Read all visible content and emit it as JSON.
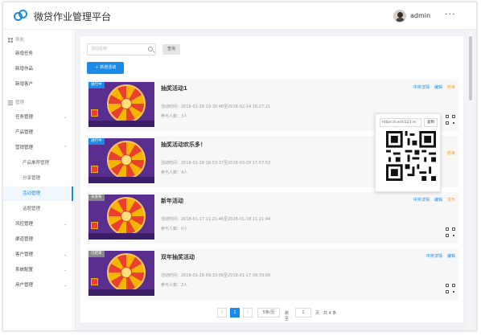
{
  "header": {
    "app_title": "微贷作业管理平台",
    "username": "admin",
    "more": "···"
  },
  "sidebar": {
    "group1": "导航",
    "group1_items": [
      "新增任务",
      "新增作品",
      "新增客户"
    ],
    "group2": "管理",
    "items": [
      {
        "label": "任务管理",
        "caret": "⌄"
      },
      {
        "label": "产品管理",
        "caret": ""
      },
      {
        "label": "营销管理",
        "caret": "⌃"
      },
      {
        "label": "产品推荐管理",
        "caret": ""
      },
      {
        "label": "分享管理",
        "caret": ""
      },
      {
        "label": "活动管理",
        "caret": ""
      },
      {
        "label": "话题管理",
        "caret": ""
      },
      {
        "label": "风控管理",
        "caret": "⌄"
      },
      {
        "label": "渠道管理",
        "caret": ""
      },
      {
        "label": "客户管理",
        "caret": "⌄"
      },
      {
        "label": "系统配置",
        "caret": "⌄"
      },
      {
        "label": "用户管理",
        "caret": "⌄"
      }
    ]
  },
  "toolbar": {
    "search_placeholder": "活动名称",
    "search_button": "查询",
    "add_button": "＋ 新增活动"
  },
  "cards": [
    {
      "badge": "进行中",
      "title": "抽奖活动1",
      "time": "活动时间：2018-01-18 19:30:48至2018-02-14 16:27:21",
      "people": "参与人数：3人",
      "links": [
        "中奖详情",
        "编辑",
        "结束"
      ]
    },
    {
      "badge": "进行中",
      "title": "抽奖活动欢乐多！",
      "time": "活动时间：2018-01-18 16:53:37至2018-03-29 17:57:53",
      "people": "参与人数：4人",
      "links": [
        "结束"
      ]
    },
    {
      "badge": "未发布",
      "title": "新年活动",
      "time": "活动时间：2018-01-17 11:21:46至2018-01-18 11:21:44",
      "people": "参与人数：0人",
      "links": [
        "中奖详情",
        "编辑",
        "发布"
      ]
    },
    {
      "badge": "已结束",
      "title": "双年抽奖活动",
      "time": "活动时间：2018-01-16 09:33:06至2018-01-17 09:39:00",
      "people": "参与人数：2人",
      "links": [
        "中奖详情",
        "编辑"
      ]
    }
  ],
  "popover": {
    "url": "https://ceshi123.m",
    "copy": "复制"
  },
  "pager": {
    "prev": "‹",
    "current": "1",
    "next": "›",
    "page_size": "5条/页",
    "goto_label": "跳至",
    "goto_value": "1",
    "page_unit": "页",
    "total": "共 4 条"
  },
  "colors": {
    "accent": "#1a8be8",
    "orange": "#f5a623"
  }
}
